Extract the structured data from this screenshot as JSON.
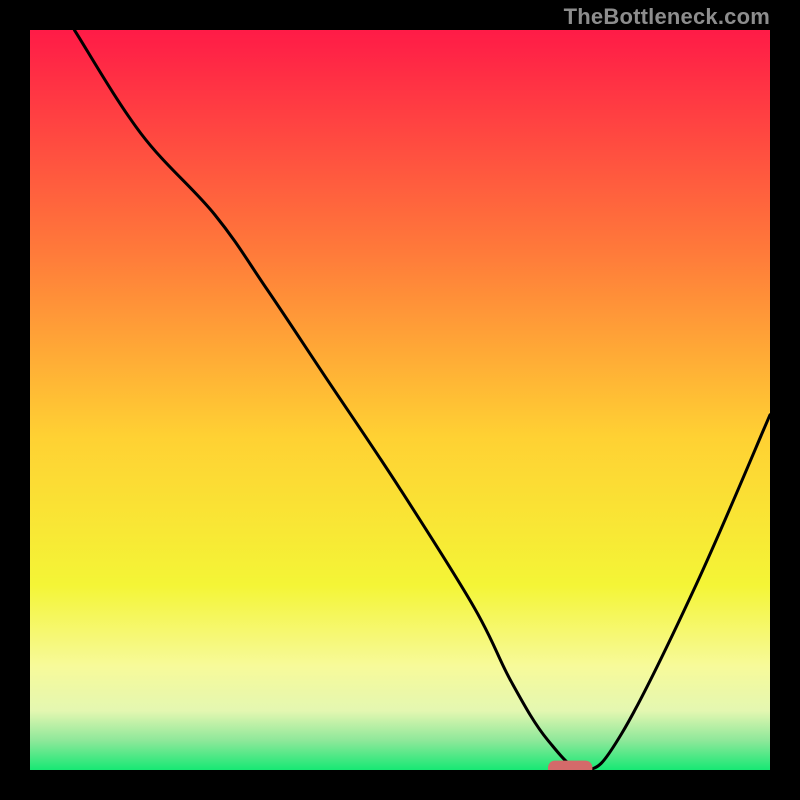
{
  "watermark": "TheBottleneck.com",
  "chart_data": {
    "type": "line",
    "title": "",
    "xlabel": "",
    "ylabel": "",
    "xlim": [
      0,
      100
    ],
    "ylim": [
      0,
      100
    ],
    "grid": false,
    "legend": false,
    "background_gradient": [
      {
        "pct": 0,
        "color": "#ff1b47"
      },
      {
        "pct": 30,
        "color": "#ff7a3a"
      },
      {
        "pct": 55,
        "color": "#ffd133"
      },
      {
        "pct": 75,
        "color": "#f4f536"
      },
      {
        "pct": 86,
        "color": "#f7fa9a"
      },
      {
        "pct": 92,
        "color": "#e4f7b1"
      },
      {
        "pct": 96,
        "color": "#8ee89a"
      },
      {
        "pct": 100,
        "color": "#17e874"
      }
    ],
    "series": [
      {
        "name": "bottleneck-curve",
        "color": "#000000",
        "x": [
          6,
          15,
          25,
          32,
          40,
          50,
          60,
          65,
          70,
          75,
          80,
          90,
          100
        ],
        "y": [
          100,
          86,
          75,
          65,
          53,
          38,
          22,
          12,
          4,
          0,
          5,
          25,
          48
        ]
      }
    ],
    "marker": {
      "name": "optimal-point",
      "x": 73,
      "y": 0,
      "color": "#d46a6a",
      "width": 6,
      "height": 2
    }
  }
}
